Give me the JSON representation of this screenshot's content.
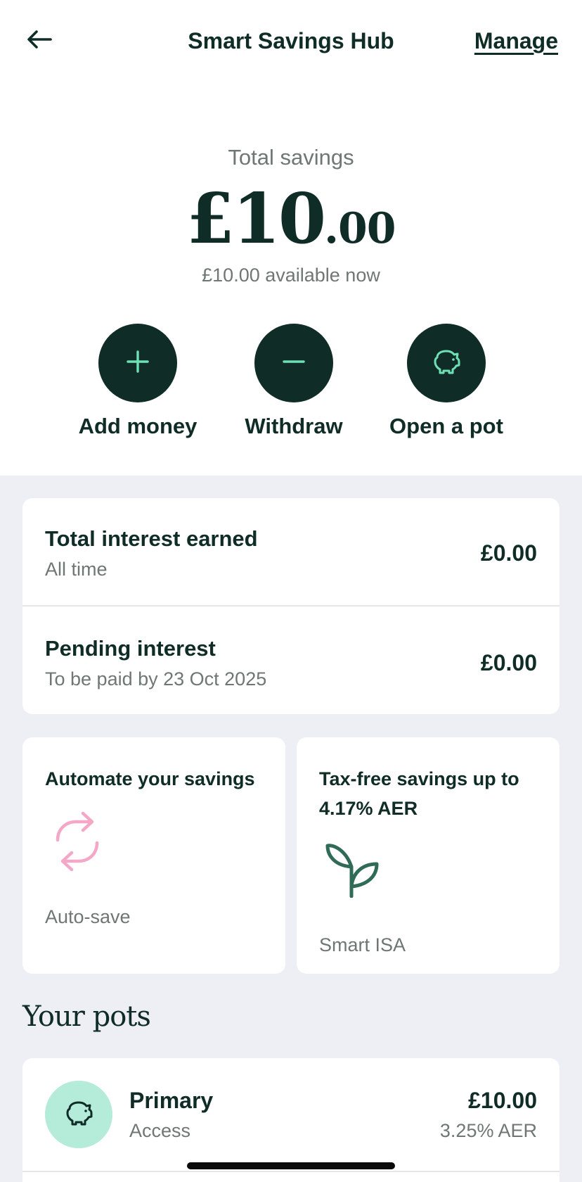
{
  "header": {
    "title": "Smart Savings Hub",
    "manage_label": "Manage",
    "back_icon": "arrow-left-icon"
  },
  "summary": {
    "label": "Total savings",
    "amount_major": "£10",
    "amount_minor": ".00",
    "available": "£10.00 available now"
  },
  "actions": [
    {
      "label": "Add money",
      "icon": "plus-icon"
    },
    {
      "label": "Withdraw",
      "icon": "minus-icon"
    },
    {
      "label": "Open a pot",
      "icon": "piggy-bank-icon"
    }
  ],
  "interest": [
    {
      "title": "Total interest earned",
      "subtitle": "All time",
      "value": "£0.00"
    },
    {
      "title": "Pending interest",
      "subtitle": "To be paid by 23 Oct 2025",
      "value": "£0.00"
    }
  ],
  "tiles": [
    {
      "title": "Automate your savings",
      "subtitle": "Auto-save",
      "icon": "refresh-icon",
      "icon_color": "#f4a7c6"
    },
    {
      "title": "Tax-free savings up to 4.17% AER",
      "subtitle": "Smart ISA",
      "icon": "sprout-icon",
      "icon_color": "#2f6b55"
    }
  ],
  "pots": {
    "heading": "Your pots",
    "items": [
      {
        "name": "Primary",
        "type": "Access",
        "amount": "£10.00",
        "rate": "3.25% AER",
        "icon": "piggy-bank-icon"
      }
    ]
  },
  "colors": {
    "brand_dark": "#0f2d26",
    "accent_mint": "#6fe0b6",
    "avatar_mint": "#b5ecd9",
    "background": "#eeeef5"
  }
}
